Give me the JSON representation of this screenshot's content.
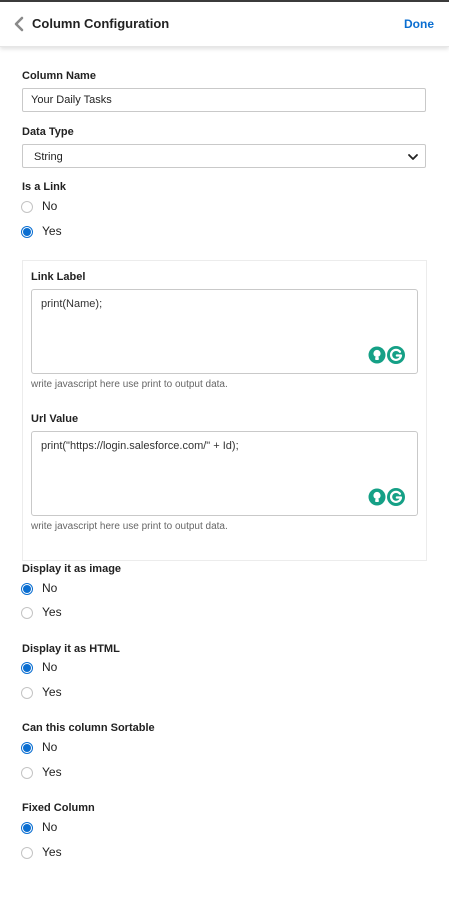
{
  "header": {
    "title": "Column Configuration",
    "done_label": "Done"
  },
  "column_name": {
    "label": "Column Name",
    "value": "Your Daily Tasks"
  },
  "data_type": {
    "label": "Data Type",
    "value": "String"
  },
  "is_link": {
    "label": "Is a Link",
    "options": [
      "No",
      "Yes"
    ],
    "selected": "Yes"
  },
  "link_panel": {
    "link_label": {
      "label": "Link Label",
      "code": "print(Name);",
      "hint": "write javascript here use print to output data."
    },
    "url_value": {
      "label": "Url Value",
      "code": "print(\"https://login.salesforce.com/\" + Id);",
      "hint": "write javascript here use print to output data."
    },
    "icons": [
      "lightbulb-icon",
      "grammarly-icon"
    ]
  },
  "display_image": {
    "label": "Display it as image",
    "options": [
      "No",
      "Yes"
    ],
    "selected": "No"
  },
  "display_html": {
    "label": "Display it as HTML",
    "options": [
      "No",
      "Yes"
    ],
    "selected": "No"
  },
  "sortable": {
    "label": "Can this column Sortable",
    "options": [
      "No",
      "Yes"
    ],
    "selected": "No"
  },
  "fixed_column": {
    "label": "Fixed Column",
    "options": [
      "No",
      "Yes"
    ],
    "selected": "No"
  },
  "colors": {
    "accent": "#0a6ed1",
    "grammarly": "#15a086"
  }
}
